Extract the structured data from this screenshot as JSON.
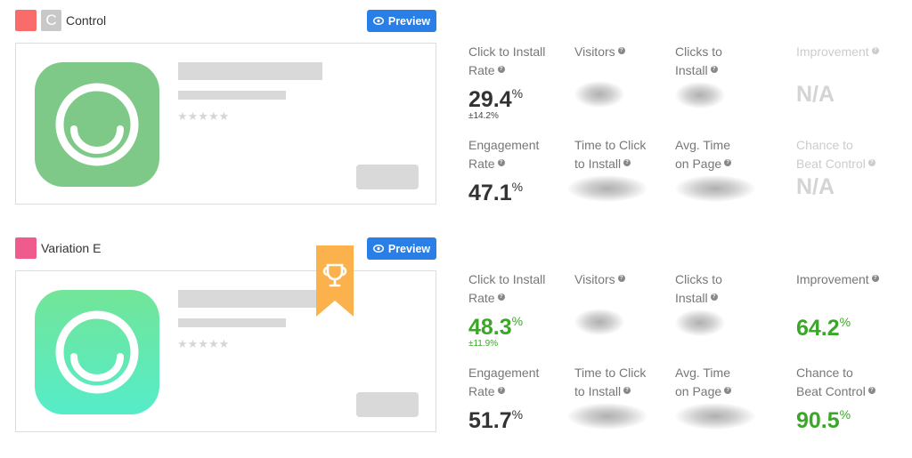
{
  "variants": [
    {
      "name": "Control",
      "badge_letter": "C",
      "swatch_color": "#fa6b6b",
      "preview_label": "Preview",
      "icon_gradient": [
        "#7ec987",
        "#7ec987"
      ],
      "winner": false,
      "metrics": {
        "click_to_install_rate": {
          "label": "Click to Install Rate",
          "value": "29.4",
          "unit": "%",
          "error": "±14.2%"
        },
        "visitors": {
          "label": "Visitors",
          "value": null
        },
        "clicks_to_install": {
          "label": "Clicks to Install",
          "value": null
        },
        "improvement": {
          "label": "Improvement",
          "value": "N/A"
        },
        "engagement_rate": {
          "label": "Engagement Rate",
          "value": "47.1",
          "unit": "%"
        },
        "time_to_click": {
          "label": "Time to Click to Install",
          "value": null
        },
        "avg_time_on_page": {
          "label": "Avg. Time on Page",
          "value": null
        },
        "chance_to_beat_control": {
          "label": "Chance to Beat Control",
          "value": "N/A"
        }
      }
    },
    {
      "name": "Variation E",
      "badge_letter": "",
      "swatch_color": "#ee5b8c",
      "preview_label": "Preview",
      "icon_gradient": [
        "#72e598",
        "#55ecc9"
      ],
      "winner": true,
      "ribbon_color": "#fbb24c",
      "metrics": {
        "click_to_install_rate": {
          "label": "Click to Install Rate",
          "value": "48.3",
          "unit": "%",
          "error": "±11.9%"
        },
        "visitors": {
          "label": "Visitors",
          "value": null
        },
        "clicks_to_install": {
          "label": "Clicks to Install",
          "value": null
        },
        "improvement": {
          "label": "Improvement",
          "value": "64.2",
          "unit": "%"
        },
        "engagement_rate": {
          "label": "Engagement Rate",
          "value": "51.7",
          "unit": "%"
        },
        "time_to_click": {
          "label": "Time to Click to Install",
          "value": null
        },
        "avg_time_on_page": {
          "label": "Avg. Time on Page",
          "value": null
        },
        "chance_to_beat_control": {
          "label": "Chance to Beat Control",
          "value": "90.5",
          "unit": "%"
        }
      }
    }
  ],
  "labels": {
    "ctr_line1": "Click to Install",
    "ctr_line2": "Rate",
    "visitors": "Visitors",
    "clicks_line1": "Clicks to",
    "clicks_line2": "Install",
    "improvement": "Improvement",
    "eng_line1": "Engagement",
    "eng_line2": "Rate",
    "ttc_line1": "Time to Click",
    "ttc_line2": "to Install",
    "atp_line1": "Avg. Time",
    "atp_line2": "on Page",
    "cbc_line1": "Chance to",
    "cbc_line2": "Beat Control",
    "help_glyph": "?"
  },
  "app_preview": {
    "star_count": 5,
    "star_glyph": "★★★★★"
  },
  "colors": {
    "accent_blue": "#2a7fe7",
    "positive_green": "#3aa728",
    "muted": "#d4d4d4"
  }
}
